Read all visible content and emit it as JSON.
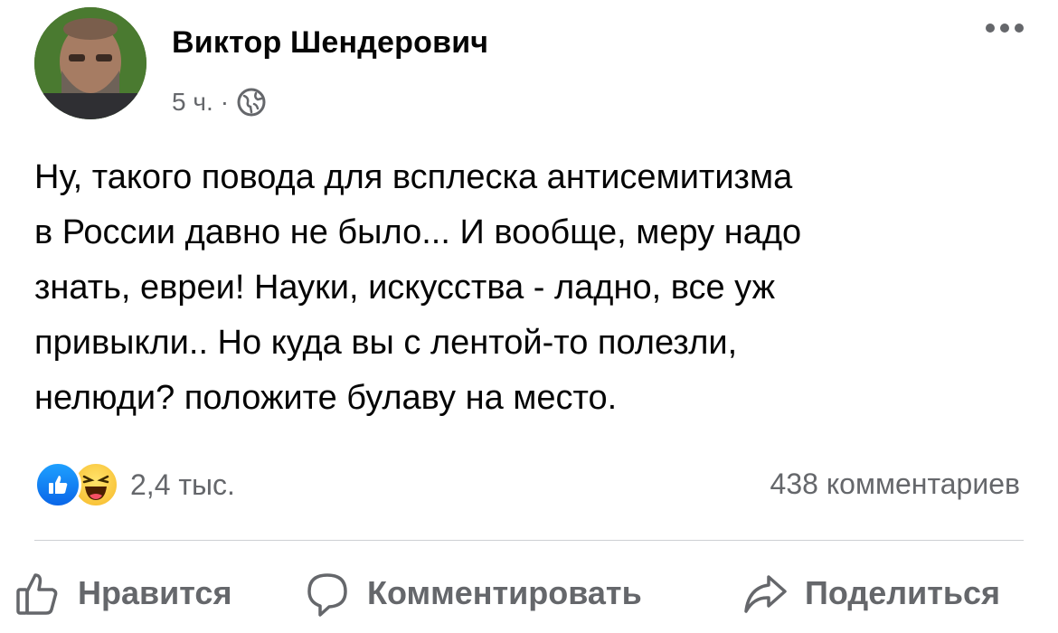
{
  "post": {
    "author": "Виктор Шендерович",
    "time": "5 ч.",
    "separator": "·",
    "privacy_icon": "globe-icon",
    "text": "Ну, такого повода для всплеска антисемитизма\nв России давно не было...  И вообще, меру надо\nзнать, евреи! Науки, искусства - ладно, все уж\nпривыкли..  Но куда вы с лентой-то полезли,\nнелюди? положите булаву на место."
  },
  "reactions": {
    "icons": [
      "like-icon",
      "haha-icon"
    ],
    "count": "2,4 тыс.",
    "comments": "438 комментариев"
  },
  "actions": {
    "like": "Нравится",
    "comment": "Комментировать",
    "share": "Поделиться"
  },
  "colors": {
    "text": "#050505",
    "secondary": "#65676b",
    "like_blue": "#0a66e8",
    "haha_yellow": "#f7b928",
    "divider": "#ced0d4"
  }
}
